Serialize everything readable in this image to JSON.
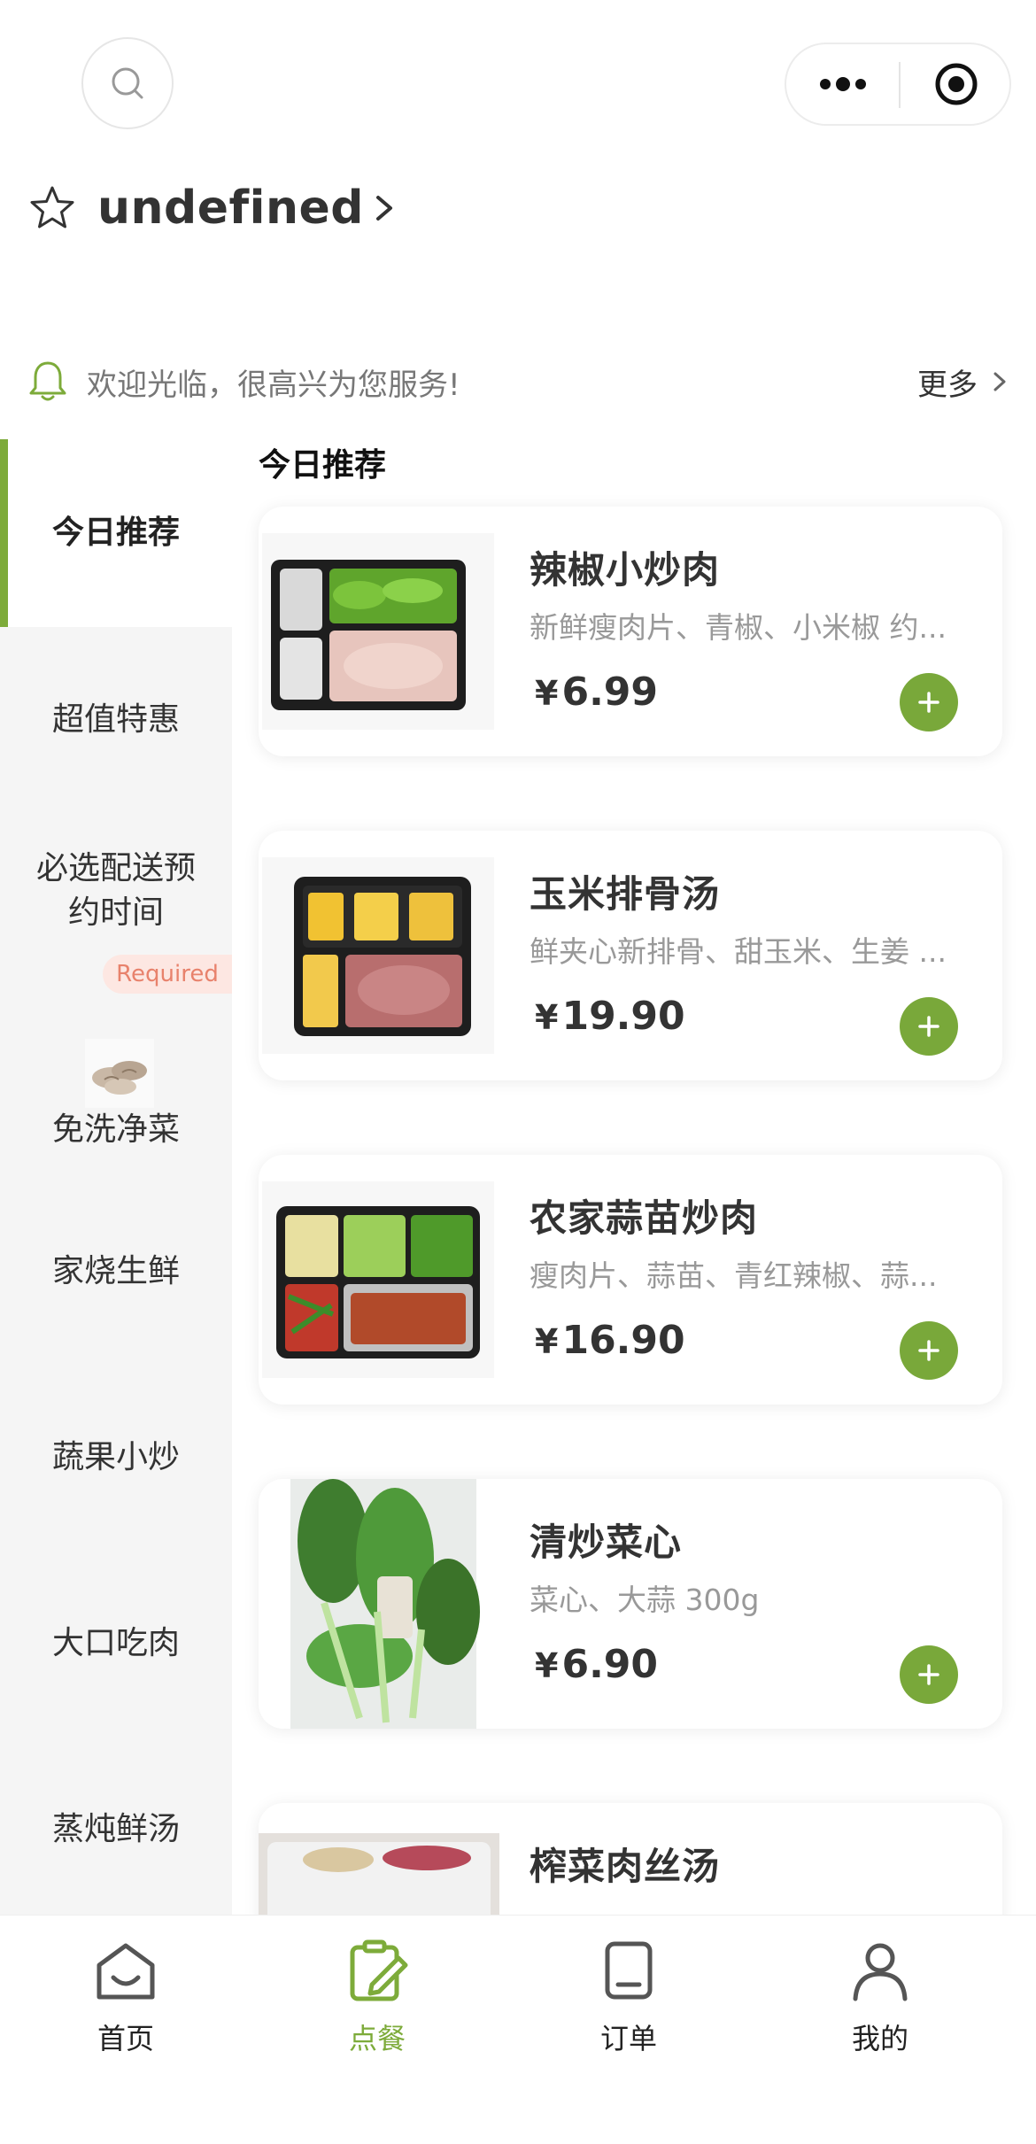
{
  "store": {
    "name": "undefined"
  },
  "notice": {
    "text": "欢迎光临，很高兴为您服务!",
    "more_label": "更多"
  },
  "section_title": "今日推荐",
  "sidebar": {
    "items": [
      {
        "label": "今日推荐"
      },
      {
        "label": "超值特惠"
      },
      {
        "label": "必选配送预约时间"
      },
      {
        "label": "免洗净菜"
      },
      {
        "label": "家烧生鲜"
      },
      {
        "label": "蔬果小炒"
      },
      {
        "label": "大口吃肉"
      },
      {
        "label": "蒸炖鲜汤"
      }
    ],
    "required_badge": "Required"
  },
  "products": [
    {
      "name": "辣椒小炒肉",
      "desc": "新鲜瘦肉片、青椒、小米椒 约...",
      "currency": "¥",
      "price": "6.99"
    },
    {
      "name": "玉米排骨汤",
      "desc": "鲜夹心新排骨、甜玉米、生姜 ...",
      "currency": "¥",
      "price": "19.90"
    },
    {
      "name": "农家蒜苗炒肉",
      "desc": "瘦肉片、蒜苗、青红辣椒、蒜...",
      "currency": "¥",
      "price": "16.90"
    },
    {
      "name": "清炒菜心",
      "desc": "菜心、大蒜 300g",
      "currency": "¥",
      "price": "6.90"
    },
    {
      "name": "榨菜肉丝汤"
    }
  ],
  "tabbar": [
    {
      "label": "首页",
      "icon": "home-icon"
    },
    {
      "label": "点餐",
      "icon": "order-food-icon",
      "active": true
    },
    {
      "label": "订单",
      "icon": "orders-icon"
    },
    {
      "label": "我的",
      "icon": "profile-icon"
    }
  ],
  "colors": {
    "accent": "#7dab3a",
    "badge_bg": "#fde7e2",
    "badge_text": "#e8826c"
  }
}
